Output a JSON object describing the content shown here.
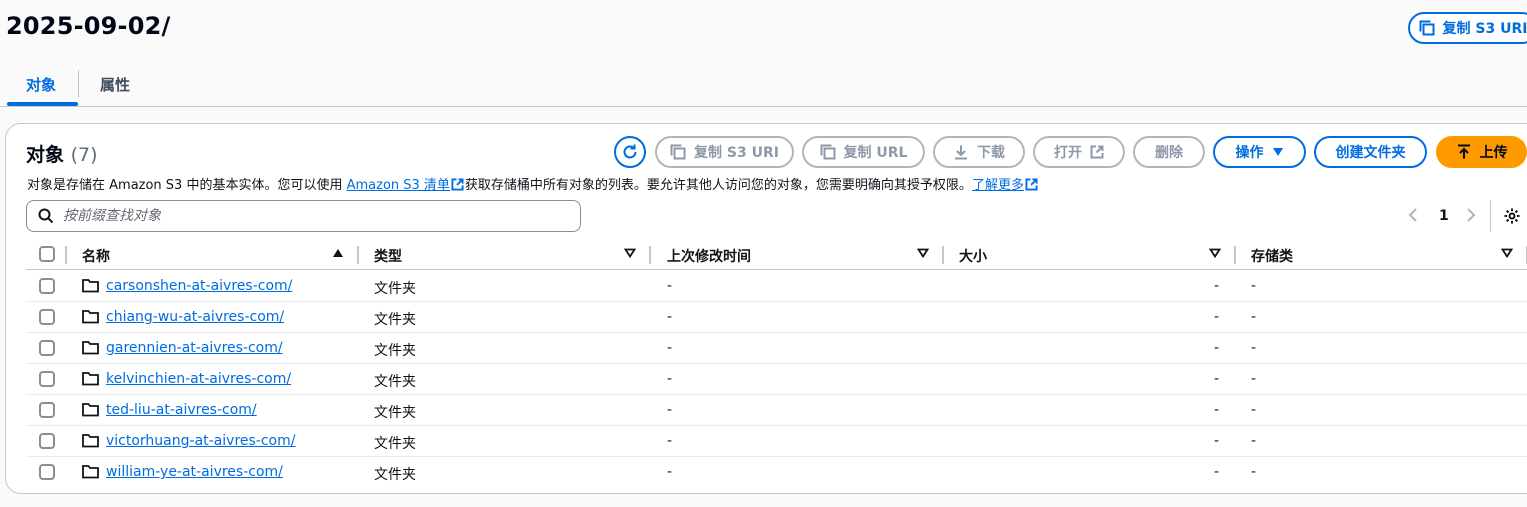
{
  "header": {
    "prefix": "2025-09-02/",
    "copy_s3_uri": "复制 S3 URI"
  },
  "tabs": [
    {
      "label": "对象",
      "active": true
    },
    {
      "label": "属性",
      "active": false
    }
  ],
  "objects_panel": {
    "title": "对象",
    "count": "(7)",
    "desc_before_link": "对象是存储在 Amazon S3 中的基本实体。您可以使用 ",
    "inventory_link": "Amazon S3 清单",
    "desc_middle": "获取存储桶中所有对象的列表。要允许其他人访问您的对象，您需要明确向其授予权限。",
    "learn_more": "了解更多",
    "buttons": {
      "copy_s3_uri": "复制 S3 URI",
      "copy_url": "复制 URL",
      "download": "下载",
      "open": "打开",
      "delete": "删除",
      "actions": "操作",
      "create_folder": "创建文件夹",
      "upload": "上传"
    },
    "search": {
      "placeholder": "按前缀查找对象",
      "value": ""
    },
    "pagination": {
      "current_page": "1"
    }
  },
  "table": {
    "columns": [
      "名称",
      "类型",
      "上次修改时间",
      "大小",
      "存储类"
    ],
    "rows": [
      {
        "name": "carsonshen-at-aivres-com/",
        "type": "文件夹",
        "last_modified": "-",
        "size": "-",
        "storage_class": "-"
      },
      {
        "name": "chiang-wu-at-aivres-com/",
        "type": "文件夹",
        "last_modified": "-",
        "size": "-",
        "storage_class": "-"
      },
      {
        "name": "garennien-at-aivres-com/",
        "type": "文件夹",
        "last_modified": "-",
        "size": "-",
        "storage_class": "-"
      },
      {
        "name": "kelvinchien-at-aivres-com/",
        "type": "文件夹",
        "last_modified": "-",
        "size": "-",
        "storage_class": "-"
      },
      {
        "name": "ted-liu-at-aivres-com/",
        "type": "文件夹",
        "last_modified": "-",
        "size": "-",
        "storage_class": "-"
      },
      {
        "name": "victorhuang-at-aivres-com/",
        "type": "文件夹",
        "last_modified": "-",
        "size": "-",
        "storage_class": "-"
      },
      {
        "name": "william-ye-at-aivres-com/",
        "type": "文件夹",
        "last_modified": "-",
        "size": "-",
        "storage_class": "-"
      }
    ]
  },
  "colors": {
    "accent": "#006ce0",
    "upload": "#ff9900",
    "disabled": "#8d99a8",
    "border": "#c6c6cd"
  }
}
